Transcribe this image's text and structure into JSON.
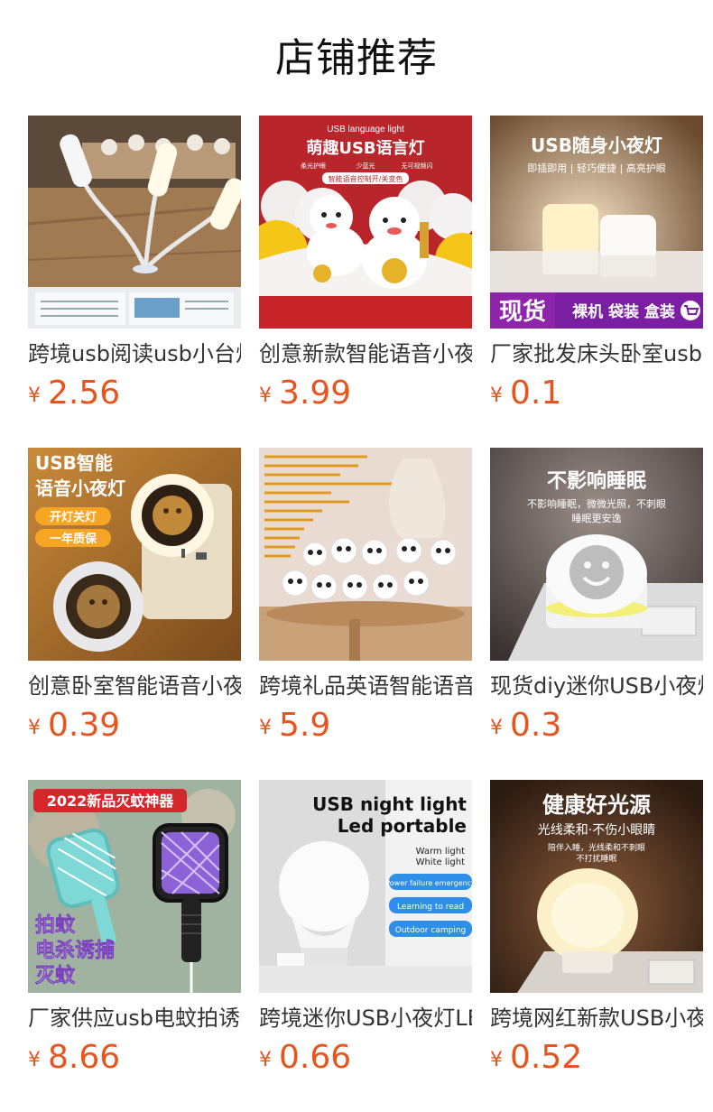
{
  "page": {
    "title": "店铺推荐"
  },
  "currency": "¥",
  "products": [
    {
      "name": "跨境usb阅读usb小台灯",
      "price": "2.56",
      "image_text": []
    },
    {
      "name": "创意新款智能语音小夜灯",
      "price": "3.99",
      "image_text": [
        "USB language light",
        "萌趣USB语言灯",
        "柔光护眼",
        "少蓝光",
        "无可视频闪",
        "智能语音控制开/关变色"
      ]
    },
    {
      "name": "厂家批发床头卧室usb小夜灯",
      "price": "0.1",
      "image_text": [
        "USB随身小夜灯",
        "即插即用 | 轻巧便捷 | 高亮护眼",
        "现货",
        "裸机 袋装 盒装"
      ]
    },
    {
      "name": "创意卧室智能语音小夜灯",
      "price": "0.39",
      "image_text": [
        "USB智能",
        "语音小夜灯",
        "开灯关灯",
        "一年质保"
      ]
    },
    {
      "name": "跨境礼品英语智能语音小夜灯",
      "price": "5.9",
      "image_text": []
    },
    {
      "name": "现货diy迷你USB小夜灯",
      "price": "0.3",
      "image_text": [
        "不影响睡眠",
        "不影响睡眠，微微光照，不刺眼",
        "睡眠更安逸"
      ]
    },
    {
      "name": "厂家供应usb电蚊拍诱捕",
      "price": "8.66",
      "image_text": [
        "2022新品灭蚊神器",
        "拍蚊",
        "电杀诱捕",
        "灭蚊"
      ]
    },
    {
      "name": "跨境迷你USB小夜灯LED",
      "price": "0.66",
      "image_text": [
        "USB night light",
        "Led portable",
        "Warm light",
        "White light",
        "Power failure emergency",
        "Learning to read",
        "Outdoor camping"
      ]
    },
    {
      "name": "跨境网红新款USB小夜灯",
      "price": "0.52",
      "image_text": [
        "健康好光源",
        "光线柔和·不伤小眼睛",
        "陪伴入睡，光线柔和不刺眼",
        "不打扰睡眠"
      ]
    }
  ]
}
